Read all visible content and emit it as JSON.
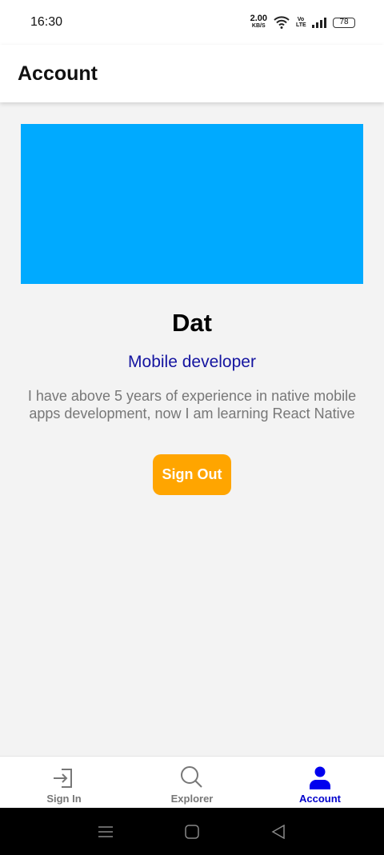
{
  "status_bar": {
    "time": "16:30",
    "speed": "2.00",
    "speed_unit": "KB/S",
    "network": "Vo LTE",
    "battery": "78"
  },
  "header": {
    "title": "Account"
  },
  "profile": {
    "banner_color": "#00aaff",
    "name": "Dat",
    "role": "Mobile developer",
    "bio": "I have above 5 years of experience in native mobile apps development, now I am learning React Native",
    "sign_out_label": "Sign Out"
  },
  "tabs": [
    {
      "label": "Sign In",
      "icon": "sign-in-icon"
    },
    {
      "label": "Explorer",
      "icon": "search-icon"
    },
    {
      "label": "Account",
      "icon": "person-icon",
      "active": true
    }
  ],
  "colors": {
    "accent": "#0000cc",
    "button": "#ffa500"
  }
}
